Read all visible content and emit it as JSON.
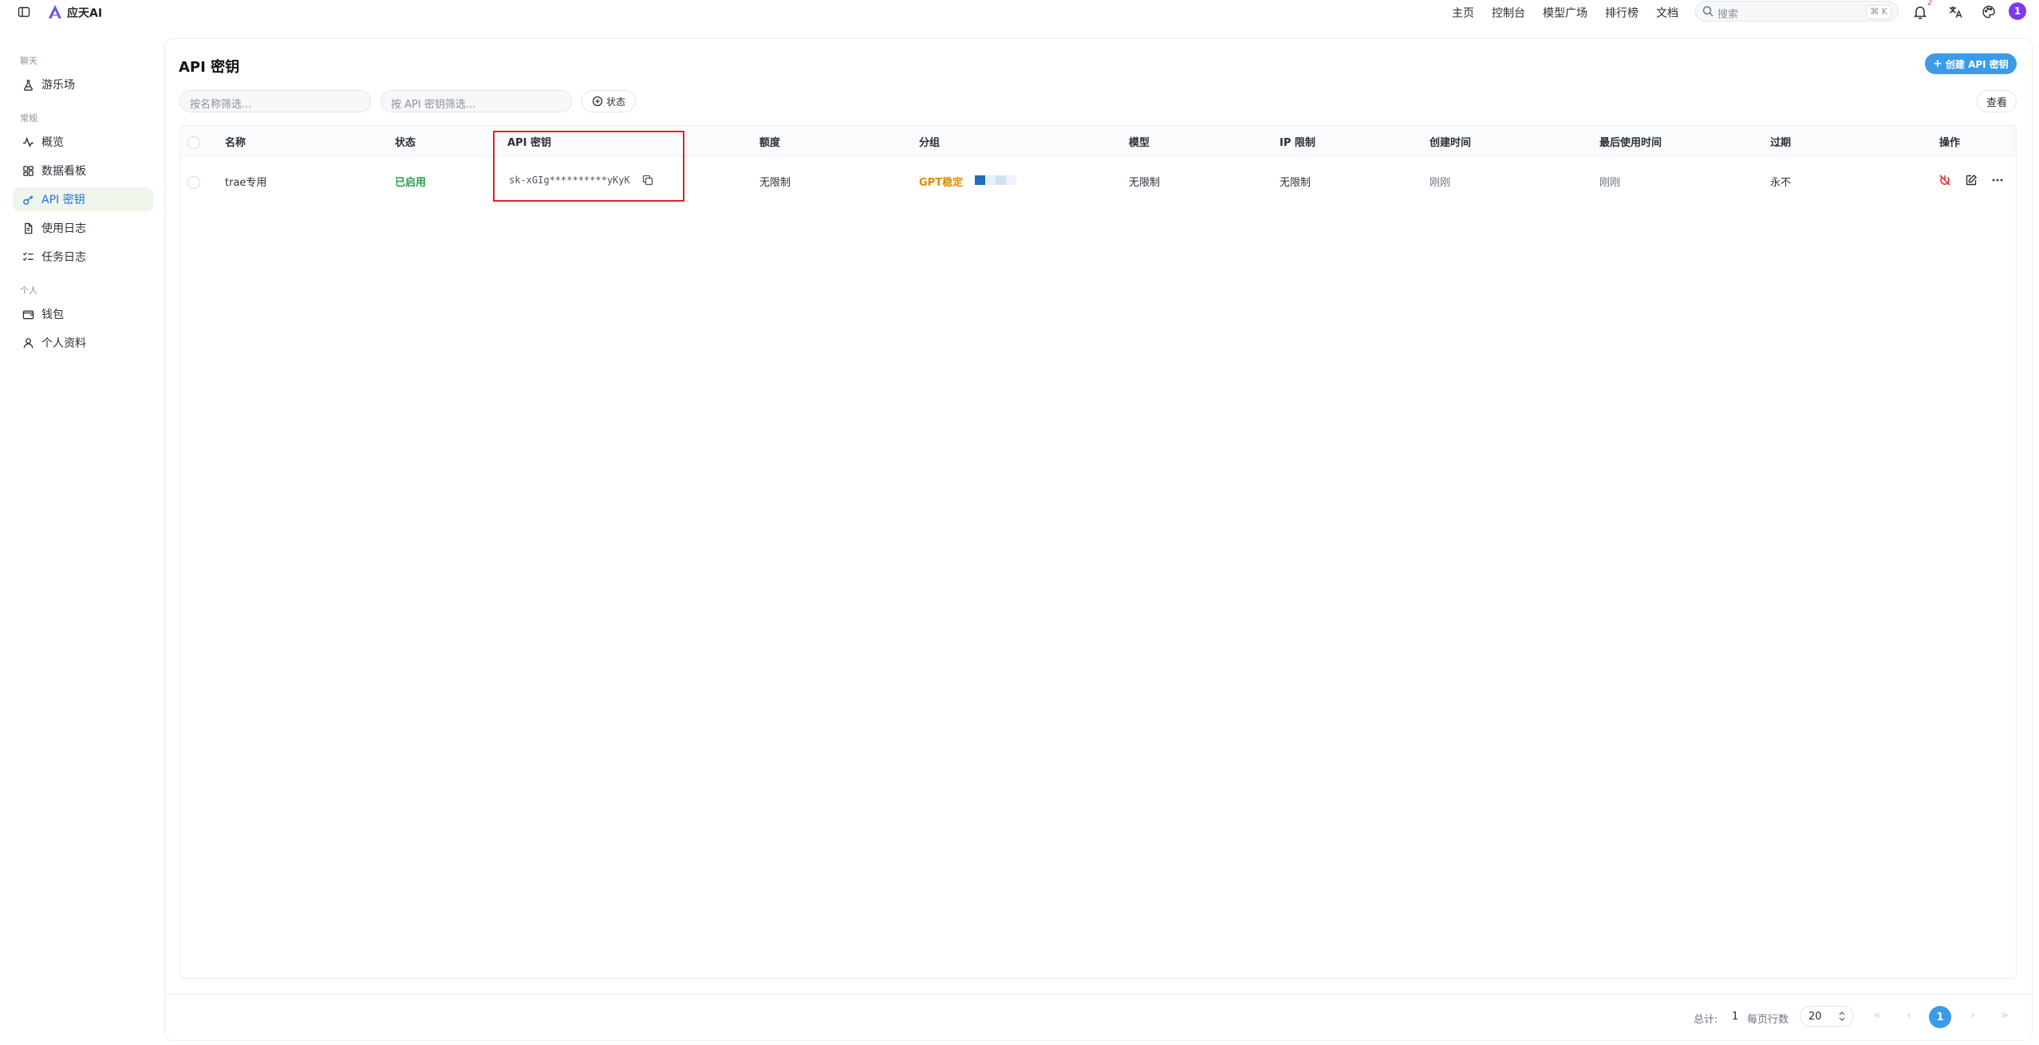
{
  "topbar": {
    "brand": "应天AI",
    "nav": [
      "主页",
      "控制台",
      "模型广场",
      "排行榜",
      "文档"
    ],
    "search_placeholder": "搜索",
    "search_shortcut": "⌘ K",
    "notification_count": "2",
    "avatar_initial": "1"
  },
  "sidebar": {
    "groups": [
      {
        "label": "聊天",
        "items": [
          {
            "label": "游乐场",
            "icon": "flask-icon"
          }
        ]
      },
      {
        "label": "常规",
        "items": [
          {
            "label": "概览",
            "icon": "activity-icon"
          },
          {
            "label": "数据看板",
            "icon": "dashboard-icon"
          },
          {
            "label": "API 密钥",
            "icon": "key-icon",
            "active": true
          },
          {
            "label": "使用日志",
            "icon": "document-icon"
          },
          {
            "label": "任务日志",
            "icon": "list-check-icon"
          }
        ]
      },
      {
        "label": "个人",
        "items": [
          {
            "label": "钱包",
            "icon": "wallet-icon"
          },
          {
            "label": "个人资料",
            "icon": "user-icon"
          }
        ]
      }
    ]
  },
  "page": {
    "title": "API 密钥",
    "create_button": "创建 API 密钥",
    "filter_name_placeholder": "按名称筛选...",
    "filter_key_placeholder": "按 API 密钥筛选...",
    "status_filter": "状态",
    "view_button": "查看"
  },
  "table": {
    "columns": [
      "名称",
      "状态",
      "API 密钥",
      "额度",
      "分组",
      "模型",
      "IP 限制",
      "创建时间",
      "最后使用时间",
      "过期",
      "操作"
    ],
    "rows": [
      {
        "name": "trae专用",
        "status": "已启用",
        "key": "sk-xGIg**********yKyK",
        "quota": "无限制",
        "group": "GPT稳定",
        "model": "无限制",
        "ip_limit": "无限制",
        "created": "刚刚",
        "last_used": "刚刚",
        "expire": "永不"
      }
    ]
  },
  "pagination": {
    "total_label": "总计:",
    "total": "1",
    "rows_per_page_label": "每页行数",
    "page_size": "20",
    "current_page": "1"
  },
  "colors": {
    "accent": "#3b9be8",
    "active_bg": "#eef6ec",
    "status_ok": "#23a04a",
    "group_tag": "#e08a00",
    "highlight": "#e5202a",
    "avatar": "#7c3aed"
  }
}
